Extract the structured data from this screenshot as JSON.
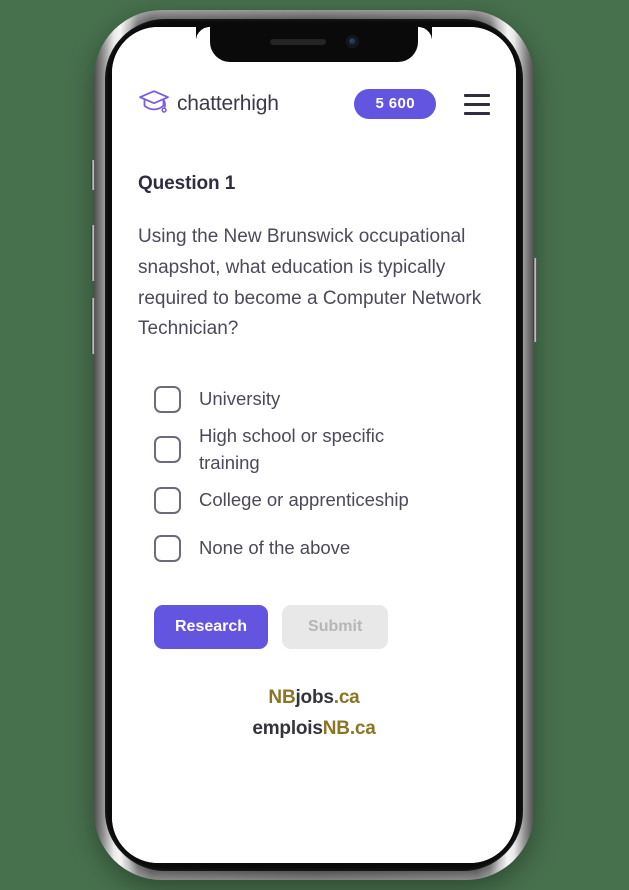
{
  "background_color": "#47704d",
  "device": {
    "type": "smartphone-mockup",
    "frame_color": "#0a0a0a",
    "screen_background": "#ffffff"
  },
  "app": {
    "brand": {
      "logo_icon": "graduation-cap-icon",
      "logo_color": "#7a5ce0",
      "name": "chatterhigh",
      "name_color": "#3b3a4d"
    },
    "points": {
      "value": "5 600",
      "background_color": "#6355e0",
      "text_color": "#ffffff"
    },
    "menu": {
      "icon": "hamburger-menu-icon",
      "color": "#2f2e41"
    },
    "question": {
      "title": "Question 1",
      "text": "Using the New Brunswick occupational snapshot, what education is typically required to become a Computer Network Technician?"
    },
    "options": [
      {
        "label": "University",
        "checked": false
      },
      {
        "label": "High school or specific training",
        "checked": false
      },
      {
        "label": "College or apprenticeship",
        "checked": false
      },
      {
        "label": "None of the above",
        "checked": false
      }
    ],
    "buttons": {
      "research": {
        "label": "Research",
        "state": "enabled",
        "color": "#6355e0"
      },
      "submit": {
        "label": "Submit",
        "state": "disabled",
        "color": "#e8e8e8"
      }
    },
    "sponsor": {
      "line1": {
        "part1": "NB",
        "part2": "jobs",
        "part3": ".ca"
      },
      "line2": {
        "part1": "emplois",
        "part2": "NB",
        "part3": ".ca"
      },
      "gold_color": "#8c7425",
      "dark_color": "#33333b"
    }
  }
}
